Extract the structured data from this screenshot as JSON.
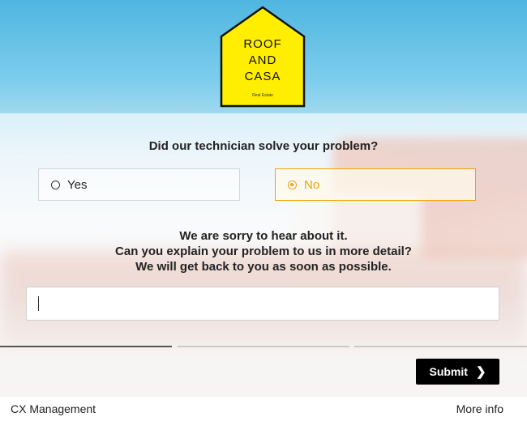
{
  "logo": {
    "line1": "ROOF",
    "line2": "AND",
    "line3": "CASA",
    "subtitle": "Real Estate",
    "color": "#ffee00"
  },
  "survey": {
    "question": "Did our technician solve your problem?",
    "options": [
      {
        "label": "Yes",
        "selected": false
      },
      {
        "label": "No",
        "selected": true
      }
    ],
    "followup": [
      "We are sorry to hear about it.",
      "Can you explain your problem to us in more detail?",
      "We will get back to you as soon as possible."
    ],
    "answer_value": "",
    "progress": {
      "steps_total": 3,
      "current_step": 1
    },
    "submit_label": "Submit",
    "submit_icon": "chevron-right-icon",
    "accent_color": "#f0a30a"
  },
  "footer": {
    "left_text": "CX Management",
    "right_link": "More info"
  }
}
